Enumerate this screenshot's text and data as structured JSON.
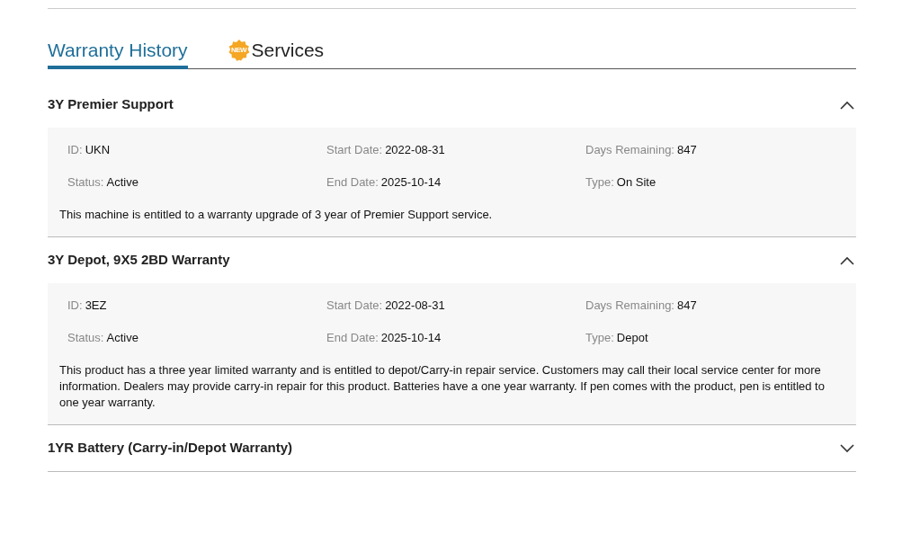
{
  "tabs": [
    {
      "label": "Warranty History",
      "selected": true
    },
    {
      "label": "Services",
      "selected": false,
      "badge": "NEW"
    }
  ],
  "warranties": [
    {
      "title": "3Y Premier Support",
      "expanded": true,
      "fields": [
        {
          "label": "ID:",
          "value": "UKN"
        },
        {
          "label": "Start Date:",
          "value": "2022-08-31"
        },
        {
          "label": "Days Remaining:",
          "value": "847"
        },
        {
          "label": "Status:",
          "value": "Active"
        },
        {
          "label": "End Date:",
          "value": "2025-10-14"
        },
        {
          "label": "Type:",
          "value": "On Site"
        }
      ],
      "description": "This machine is entitled to a warranty upgrade of 3 year of Premier Support service."
    },
    {
      "title": "3Y Depot, 9X5 2BD Warranty",
      "expanded": true,
      "fields": [
        {
          "label": "ID:",
          "value": "3EZ"
        },
        {
          "label": "Start Date:",
          "value": "2022-08-31"
        },
        {
          "label": "Days Remaining:",
          "value": "847"
        },
        {
          "label": "Status:",
          "value": "Active"
        },
        {
          "label": "End Date:",
          "value": "2025-10-14"
        },
        {
          "label": "Type:",
          "value": "Depot"
        }
      ],
      "description": "This product has a three year limited warranty and is entitled to depot/Carry-in repair service. Customers may call their local service center for more information. Dealers may provide carry-in repair for this product. Batteries have a one year warranty. If pen comes with the product, pen is entitled to one year warranty."
    },
    {
      "title": "1YR Battery (Carry-in/Depot Warranty)",
      "expanded": false
    }
  ]
}
